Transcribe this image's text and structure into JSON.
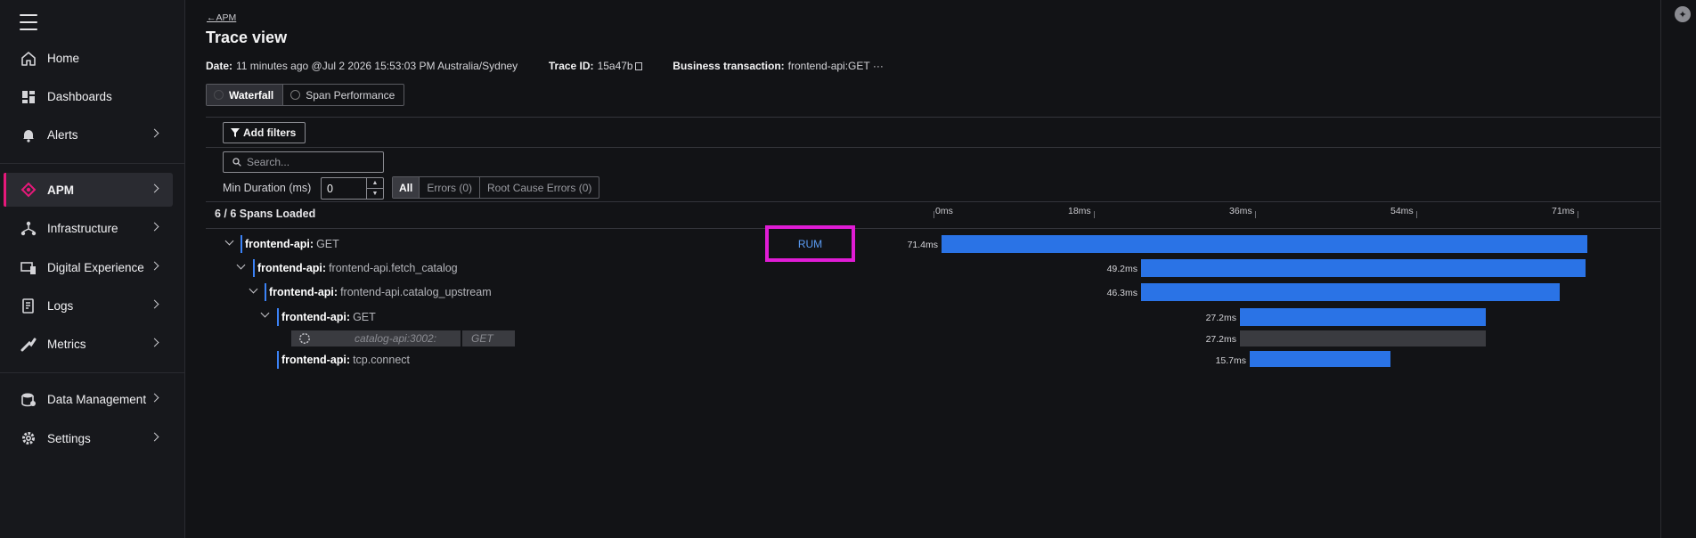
{
  "sidebar": {
    "items": [
      {
        "label": "Home",
        "icon": "home-icon"
      },
      {
        "label": "Dashboards",
        "icon": "dashboards-icon"
      },
      {
        "label": "Alerts",
        "icon": "bell-icon"
      },
      {
        "label": "APM",
        "icon": "apm-icon",
        "active": true
      },
      {
        "label": "Infrastructure",
        "icon": "infrastructure-icon"
      },
      {
        "label": "Digital Experience",
        "icon": "digital-experience-icon"
      },
      {
        "label": "Logs",
        "icon": "logs-icon"
      },
      {
        "label": "Metrics",
        "icon": "metrics-icon"
      },
      {
        "label": "Data Management",
        "icon": "database-icon"
      },
      {
        "label": "Settings",
        "icon": "gear-icon"
      }
    ]
  },
  "header": {
    "back_label": "APM",
    "title": "Trace view",
    "date_label": "Date:",
    "date_value": "11 minutes ago @Jul 2 2026 15:53:03 PM  Australia/Sydney",
    "trace_label": "Trace ID:",
    "trace_value": "15a47b",
    "business_label": "Business transaction:",
    "business_value": "frontend-api:GET ···"
  },
  "tabs": {
    "waterfall": "Waterfall",
    "span_performance": "Span Performance"
  },
  "filters": {
    "add_filters": "Add filters",
    "search_placeholder": "Search...",
    "min_duration_label": "Min Duration (ms)",
    "min_duration_value": "0",
    "segments": [
      "All",
      "Errors (0)",
      "Root Cause Errors (0)"
    ]
  },
  "waterfall": {
    "spans_loaded": "6 / 6 Spans Loaded",
    "axis": [
      "0ms",
      "18ms",
      "36ms",
      "54ms",
      "71ms"
    ],
    "rum_label": "RUM",
    "spans": [
      {
        "service": "frontend-api:",
        "operation": "GET",
        "duration": "71.4ms"
      },
      {
        "service": "frontend-api:",
        "operation": "frontend-api.fetch_catalog",
        "duration": "49.2ms"
      },
      {
        "service": "frontend-api:",
        "operation": "frontend-api.catalog_upstream",
        "duration": "46.3ms"
      },
      {
        "service": "frontend-api:",
        "operation": "GET",
        "duration": "27.2ms"
      },
      {
        "service": "catalog-api:3002:",
        "operation": "GET",
        "duration": "27.2ms"
      },
      {
        "service": "frontend-api:",
        "operation": "tcp.connect",
        "duration": "15.7ms"
      }
    ]
  },
  "colors": {
    "accent": "#e6197a",
    "bar": "#2a73e6",
    "highlight": "#e01cd5"
  }
}
